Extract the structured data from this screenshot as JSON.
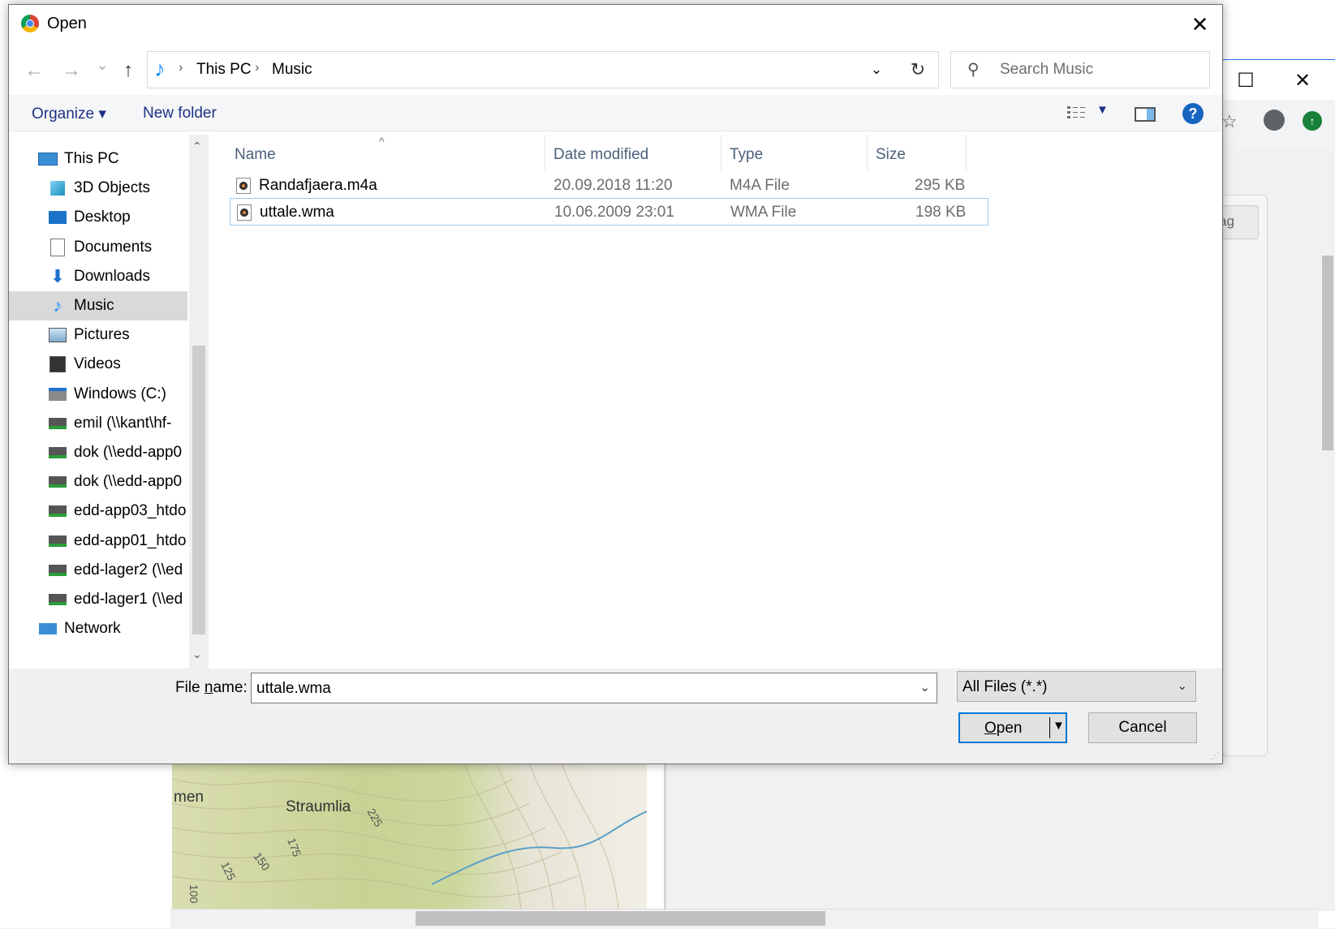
{
  "dialog": {
    "title": "Open",
    "close_glyph": "✕"
  },
  "navigation": {
    "back_glyph": "←",
    "forward_glyph": "→",
    "recent_glyph": "⌄",
    "up_glyph": "↑",
    "breadcrumb": [
      "This PC",
      "Music"
    ],
    "refresh_glyph": "↻",
    "search_placeholder": "Search Music"
  },
  "command_bar": {
    "organize": "Organize ▾",
    "new_folder": "New folder"
  },
  "tree": [
    {
      "label": "This PC",
      "icon": "pc-icon"
    },
    {
      "label": "3D Objects",
      "icon": "cube-icon"
    },
    {
      "label": "Desktop",
      "icon": "desktop-icon"
    },
    {
      "label": "Documents",
      "icon": "document-icon"
    },
    {
      "label": "Downloads",
      "icon": "download-icon"
    },
    {
      "label": "Music",
      "icon": "music-icon",
      "selected": true
    },
    {
      "label": "Pictures",
      "icon": "pictures-icon"
    },
    {
      "label": "Videos",
      "icon": "videos-icon"
    },
    {
      "label": "Windows (C:)",
      "icon": "drive-icon"
    },
    {
      "label": "emil (\\\\kant\\hf-",
      "icon": "network-drive-icon"
    },
    {
      "label": "dok (\\\\edd-app0",
      "icon": "network-drive-icon"
    },
    {
      "label": "dok (\\\\edd-app0",
      "icon": "network-drive-icon"
    },
    {
      "label": "edd-app03_htdo",
      "icon": "network-drive-icon"
    },
    {
      "label": "edd-app01_htdo",
      "icon": "network-drive-icon"
    },
    {
      "label": "edd-lager2 (\\\\ed",
      "icon": "network-drive-icon"
    },
    {
      "label": "edd-lager1 (\\\\ed",
      "icon": "network-drive-icon"
    },
    {
      "label": "Network",
      "icon": "network-icon"
    }
  ],
  "columns": [
    "Name",
    "Date modified",
    "Type",
    "Size"
  ],
  "files": [
    {
      "name": "Randafjaera.m4a",
      "date": "20.09.2018 11:20",
      "type": "M4A File",
      "size": "295 KB"
    },
    {
      "name": "uttale.wma",
      "date": "10.06.2009 23:01",
      "type": "WMA File",
      "size": "198 KB",
      "selected": true
    }
  ],
  "bottom": {
    "file_name_label_pre": "File ",
    "file_name_label_ul": "n",
    "file_name_label_post": "ame:",
    "file_name_value": "uttale.wma",
    "filter_value": "All Files (*.*)",
    "open_ul": "O",
    "open_rest": "pen",
    "cancel": "Cancel"
  },
  "background": {
    "chip_text": "ag",
    "map_labels": [
      "men",
      "Straumlia",
      "225",
      "175",
      "150",
      "125",
      "100"
    ]
  },
  "colors": {
    "accent": "#0078d7",
    "link": "#1e3287",
    "selection": "#d9d9d9",
    "selected_row_border": "#99c9ef"
  }
}
